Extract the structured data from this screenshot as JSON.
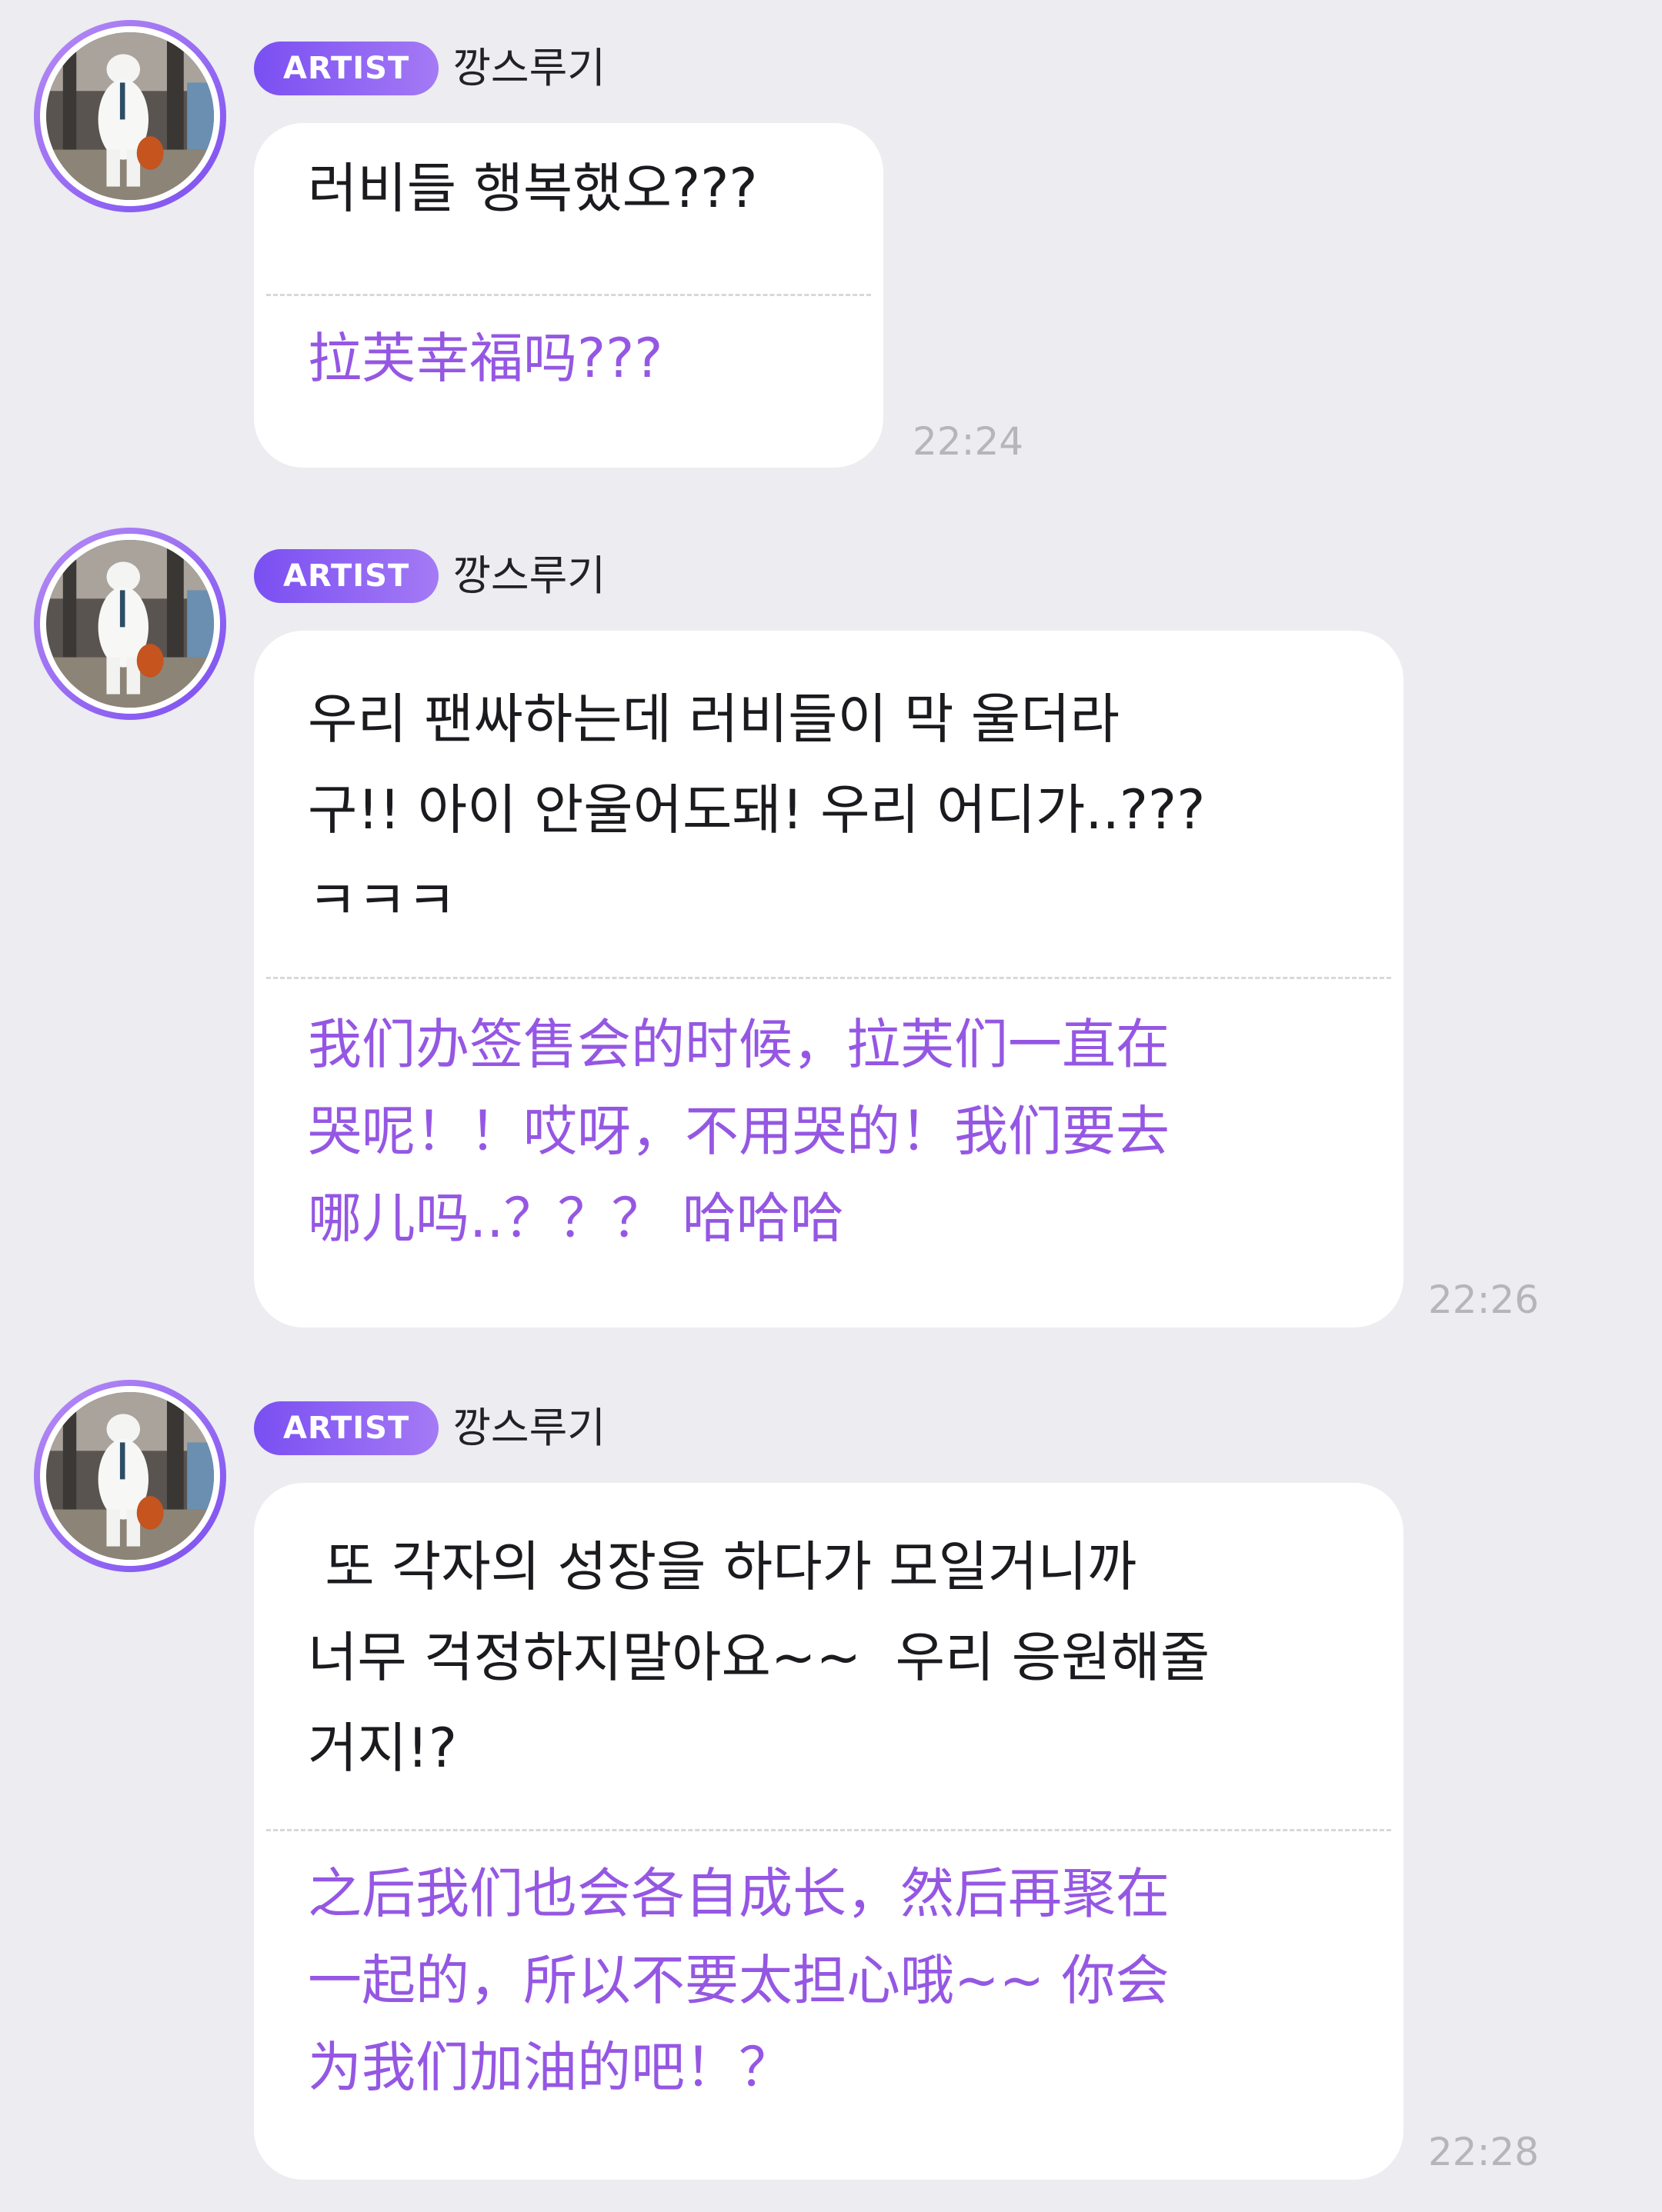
{
  "messages": [
    {
      "badge": "ARTIST",
      "nickname": "깡스루기",
      "korean": "러비들 행복했오???",
      "chinese": "拉芙幸福吗???",
      "time": "22:24"
    },
    {
      "badge": "ARTIST",
      "nickname": "깡스루기",
      "korean": "우리 팬싸하는데 러비들이 막 울더라\n구!! 아이 안울어도돼! 우리 어디가..???\nㅋㅋㅋ",
      "chinese": "我们办签售会的时候，拉芙们一直在\n哭呢！！哎呀，不用哭的！我们要去\n哪儿吗..？？？ 哈哈哈",
      "time": "22:26"
    },
    {
      "badge": "ARTIST",
      "nickname": "깡스루기",
      "korean": " 또 각자의 성장을 하다가 모일거니까\n너무 걱정하지말아요~~  우리 응원해줄\n거지!?",
      "chinese": "之后我们也会各自成长，然后再聚在\n一起的，所以不要太担心哦~~ 你会\n为我们加油的吧！？",
      "time": "22:28"
    }
  ]
}
